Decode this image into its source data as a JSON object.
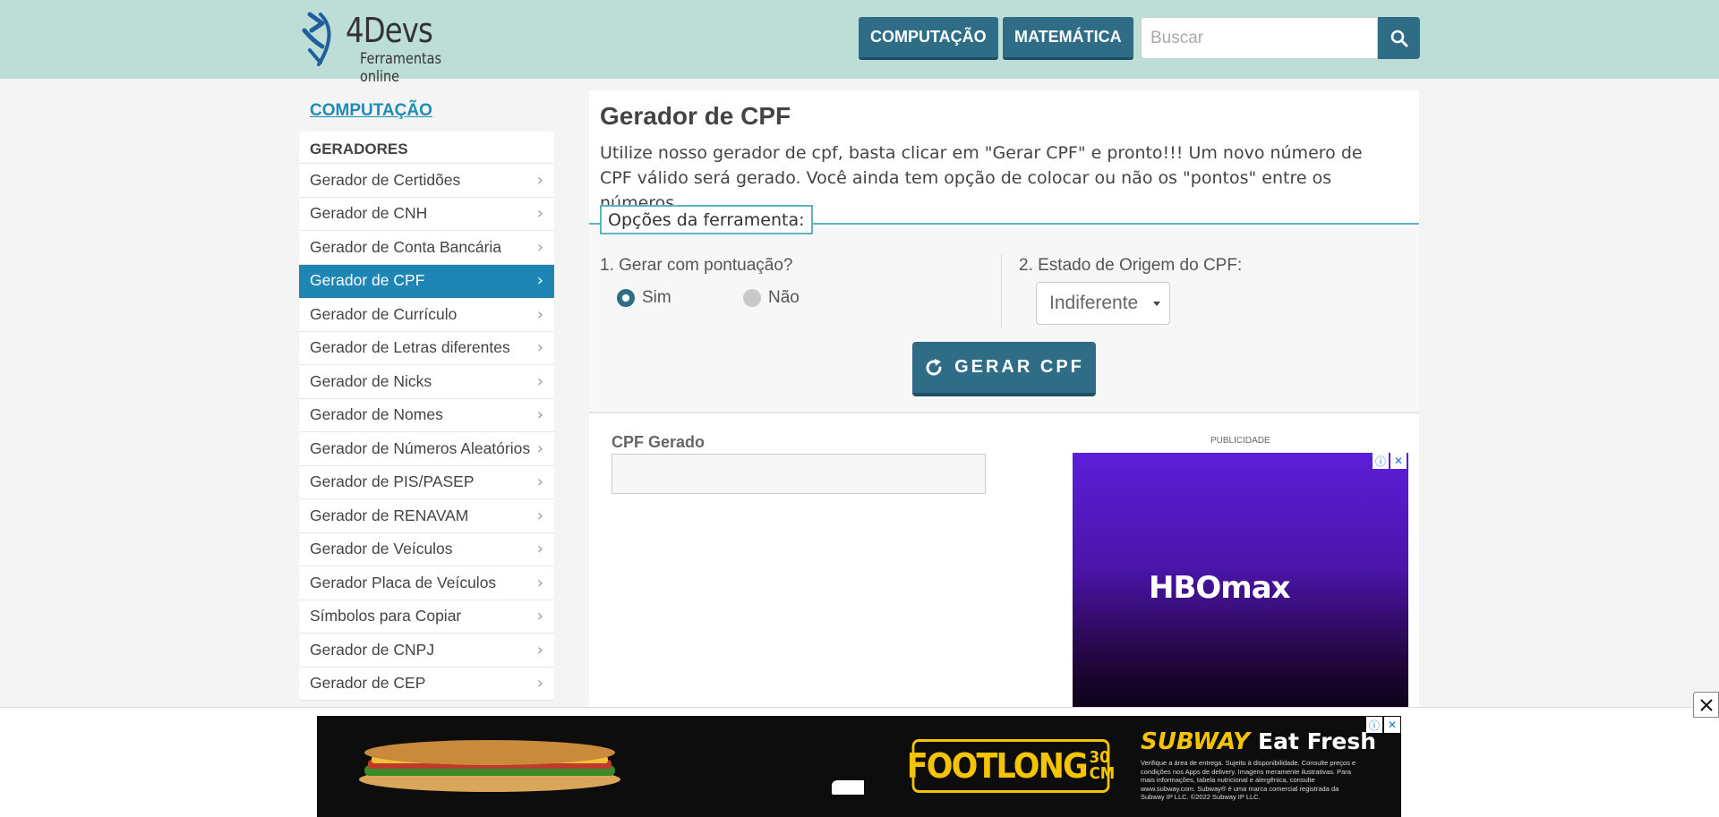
{
  "header": {
    "logo_title": "4Devs",
    "logo_subtitle": "Ferramentas online",
    "nav": [
      "COMPUTAÇÃO",
      "MATEMÁTICA"
    ],
    "search_placeholder": "Buscar",
    "accent_color": "#2f6c85",
    "header_bg": "#bcded6"
  },
  "sidebar": {
    "title": "COMPUTAÇÃO",
    "section": "GERADORES",
    "items": [
      {
        "label": "Gerador de Certidões",
        "active": false
      },
      {
        "label": "Gerador de CNH",
        "active": false
      },
      {
        "label": "Gerador de Conta Bancária",
        "active": false
      },
      {
        "label": "Gerador de CPF",
        "active": true
      },
      {
        "label": "Gerador de Currículo",
        "active": false
      },
      {
        "label": "Gerador de Letras diferentes",
        "active": false
      },
      {
        "label": "Gerador de Nicks",
        "active": false
      },
      {
        "label": "Gerador de Nomes",
        "active": false
      },
      {
        "label": "Gerador de Números Aleatórios",
        "active": false
      },
      {
        "label": "Gerador de PIS/PASEP",
        "active": false
      },
      {
        "label": "Gerador de RENAVAM",
        "active": false
      },
      {
        "label": "Gerador de Veículos",
        "active": false
      },
      {
        "label": "Gerador Placa de Veículos",
        "active": false
      },
      {
        "label": "Símbolos para Copiar",
        "active": false
      },
      {
        "label": "Gerador de CNPJ",
        "active": false
      },
      {
        "label": "Gerador de CEP",
        "active": false
      }
    ]
  },
  "main": {
    "title": "Gerador de CPF",
    "description": "Utilize nosso gerador de cpf, basta clicar em \"Gerar CPF\" e pronto!!! Um novo número de CPF válido será gerado. Você ainda tem opção de colocar ou não os \"pontos\" entre os números.",
    "options_legend": "Opções da ferramenta:",
    "q1_label": "1. Gerar com pontuação?",
    "q1_options": [
      {
        "label": "Sim",
        "selected": true
      },
      {
        "label": "Não",
        "selected": false
      }
    ],
    "q2_label": "2. Estado de Origem do CPF:",
    "q2_value": "Indiferente",
    "generate_button": "GERAR CPF",
    "result_label": "CPF Gerado",
    "result_value": ""
  },
  "ads": {
    "side_label": "PUBLICIDADE",
    "side_brand": "HBOmax",
    "bottom_brand": "SUBWAY",
    "bottom_tagline": "Eat Fresh",
    "bottom_product": "FOOTLONG",
    "bottom_product_size": "30 CM",
    "bottom_fineprint": "Verifique a área de entrega. Sujeito à disponibilidade. Consulte preços e condições nos Apps de delivery. Imagens meramente ilustrativas. Para mais informações, tabela nutricional e alergênica, consulte www.subway.com. Subway® é uma marca comercial registrada da Subway IP LLC. ©2022 Subway IP LLC."
  }
}
